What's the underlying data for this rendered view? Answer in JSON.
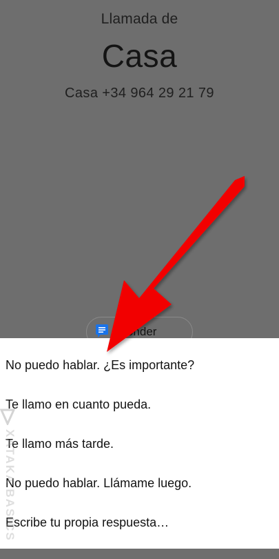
{
  "incoming_call": {
    "call_from_label": "Llamada de",
    "caller_name": "Casa",
    "caller_number": "Casa +34 964 29 21 79"
  },
  "reply_chip": {
    "label": "Responder",
    "visible_label": "sponder",
    "icon": "message-icon"
  },
  "quick_replies": [
    {
      "label": "No puedo hablar. ¿Es importante?"
    },
    {
      "label": "Te llamo en cuanto pueda."
    },
    {
      "label": "Te llamo más tarde."
    },
    {
      "label": "No puedo hablar. Llámame luego."
    },
    {
      "label": "Escribe tu propia respuesta…"
    }
  ],
  "watermark": {
    "text": "XATAKA BASICS"
  },
  "annotation": {
    "icon": "red-arrow-icon",
    "color": "#ff0000"
  },
  "colors": {
    "dim_background": "#6e6e6e",
    "sheet_background": "#ffffff",
    "chip_icon": "#1a73e8"
  }
}
